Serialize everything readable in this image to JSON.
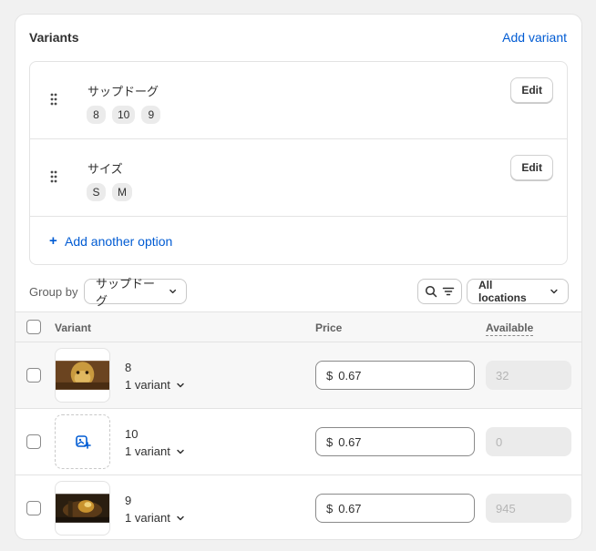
{
  "header": {
    "title": "Variants",
    "add_variant_label": "Add variant"
  },
  "options": [
    {
      "name": "サップドーグ",
      "values": [
        "8",
        "10",
        "9"
      ],
      "edit_label": "Edit"
    },
    {
      "name": "サイズ",
      "values": [
        "S",
        "M"
      ],
      "edit_label": "Edit"
    }
  ],
  "add_option_label": "Add another option",
  "toolbar": {
    "group_by_label": "Group by",
    "group_by_value": "サップドーグ",
    "locations_value": "All locations"
  },
  "table": {
    "headers": {
      "variant": "Variant",
      "price": "Price",
      "available": "Available"
    },
    "rows": [
      {
        "name": "8",
        "sub_label": "1 variant",
        "currency": "$",
        "price": "0.67",
        "available": "32",
        "thumbnail": "photo"
      },
      {
        "name": "10",
        "sub_label": "1 variant",
        "currency": "$",
        "price": "0.67",
        "available": "0",
        "thumbnail": "add-image-icon"
      },
      {
        "name": "9",
        "sub_label": "1 variant",
        "currency": "$",
        "price": "0.67",
        "available": "945",
        "thumbnail": "photo"
      }
    ]
  },
  "colors": {
    "link": "#005bd3",
    "border": "#e3e3e3",
    "muted": "#616161"
  }
}
